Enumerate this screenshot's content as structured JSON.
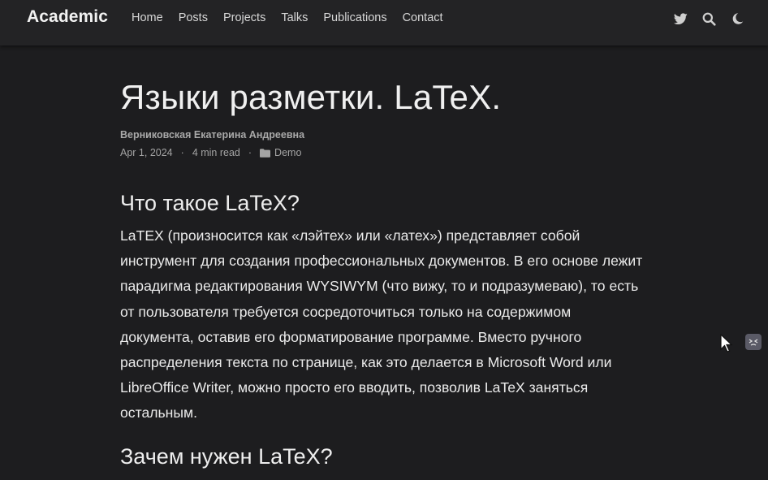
{
  "navbar": {
    "brand": "Academic",
    "links": [
      "Home",
      "Posts",
      "Projects",
      "Talks",
      "Publications",
      "Contact"
    ],
    "icons": [
      "twitter-icon",
      "search-icon",
      "dark-mode-moon-icon"
    ]
  },
  "article": {
    "title": "Языки разметки. LaTeX.",
    "author": "Верниковская Екатерина Андреевна",
    "date": "Apr 1, 2024",
    "sep": "·",
    "read_time": "4 min read",
    "category": "Demo",
    "section1_heading": "Что такое LaTeX?",
    "section1_text": "LaTEX (произносится как «лэйтех» или «латех») представляет собой инструмент для создания профессиональных документов. В его основе лежит парадигма редактирования WYSIWYM (что вижу, то и подразумеваю), то есть от пользователя требуется сосредоточиться только на содержимом документа, оставив его форматирование программе. Вместо ручного распределения текста по странице, как это делается в Microsoft Word или LibreOffice Writer, можно просто его вводить, позволив LaTeX заняться остальным.",
    "section2_heading": "Зачем нужен LaTeX?"
  },
  "colors": {
    "background": "#1d1d1f",
    "navbar": "#232325",
    "text": "#eaeaea",
    "muted": "#a4a4a4"
  }
}
